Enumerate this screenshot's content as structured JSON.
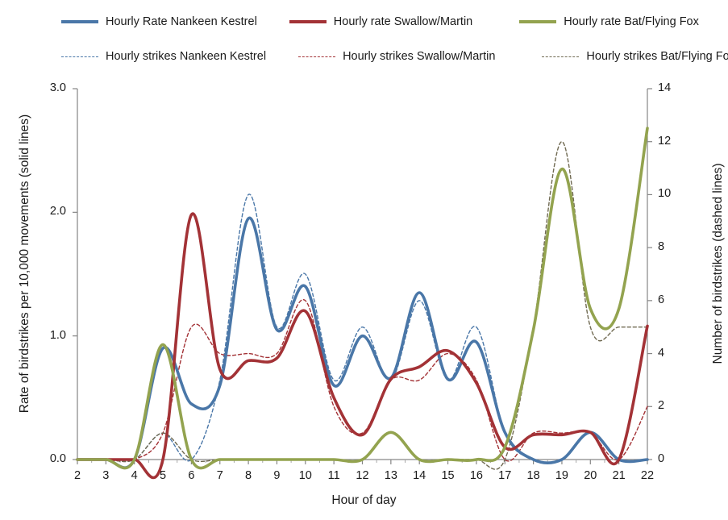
{
  "legend": {
    "rows": [
      [
        {
          "label": "Hourly Rate Nankeen Kestrel",
          "style": "solid",
          "color": "#4a77a8",
          "name": "legend-rate-nankeen-kestrel"
        },
        {
          "label": "Hourly rate Swallow/Martin",
          "style": "solid",
          "color": "#a33236",
          "name": "legend-rate-swallow-martin"
        },
        {
          "label": "Hourly rate Bat/Flying Fox",
          "style": "solid",
          "color": "#93a34f",
          "name": "legend-rate-bat-flying-fox"
        }
      ],
      [
        {
          "label": "Hourly strikes Nankeen Kestrel",
          "style": "dashed",
          "color": "#4a77a8",
          "name": "legend-strikes-nankeen-kestrel"
        },
        {
          "label": "Hourly strikes Swallow/Martin",
          "style": "dashed",
          "color": "#a33236",
          "name": "legend-strikes-swallow-martin"
        },
        {
          "label": "Hourly strikes Bat/Flying Fox",
          "style": "dashed",
          "color": "#706a52",
          "name": "legend-strikes-bat-flying-fox"
        }
      ]
    ]
  },
  "chart_data": {
    "type": "line",
    "title": "",
    "xlabel": "Hour of day",
    "ylabel": "Rate of birdstrikes per 10,000 movements (solid lines)",
    "ylabel_right": "Number of birdstrikes (dashed lines)",
    "grid": false,
    "legend_position": "top",
    "x": [
      2,
      3,
      4,
      5,
      6,
      7,
      8,
      9,
      10,
      11,
      12,
      13,
      14,
      15,
      16,
      17,
      18,
      19,
      20,
      21,
      22
    ],
    "xtick_labels": [
      "2",
      "3",
      "4",
      "5",
      "6",
      "7",
      "8",
      "9",
      "10",
      "11",
      "12",
      "13",
      "14",
      "15",
      "16",
      "17",
      "18",
      "19",
      "20",
      "21",
      "22"
    ],
    "xlim": [
      2,
      22
    ],
    "ylim": [
      0.0,
      3.0
    ],
    "ytick_labels": [
      "0.0",
      "1.0",
      "2.0",
      "3.0"
    ],
    "ytick_values": [
      0.0,
      1.0,
      2.0,
      3.0
    ],
    "ylim_right": [
      0,
      14
    ],
    "ytick_labels_right": [
      "0",
      "2",
      "4",
      "6",
      "8",
      "10",
      "12",
      "14"
    ],
    "ytick_values_right": [
      0,
      2,
      4,
      6,
      8,
      10,
      12,
      14
    ],
    "series": [
      {
        "name": "Hourly Rate Nankeen Kestrel",
        "axis": "left",
        "style": "solid",
        "color": "#4a77a8",
        "values": [
          0.0,
          0.0,
          0.0,
          0.9,
          0.45,
          0.6,
          1.95,
          1.05,
          1.4,
          0.6,
          1.0,
          0.66,
          1.35,
          0.65,
          0.95,
          0.22,
          0.0,
          0.0,
          0.22,
          0.0,
          0.0
        ]
      },
      {
        "name": "Hourly rate Swallow/Martin",
        "axis": "left",
        "style": "solid",
        "color": "#a33236",
        "values": [
          0.0,
          0.0,
          0.0,
          0.0,
          1.98,
          0.73,
          0.8,
          0.82,
          1.2,
          0.5,
          0.2,
          0.65,
          0.75,
          0.88,
          0.62,
          0.1,
          0.2,
          0.2,
          0.22,
          0.0,
          1.08
        ]
      },
      {
        "name": "Hourly rate Bat/Flying Fox",
        "axis": "left",
        "style": "solid",
        "color": "#93a34f",
        "values": [
          0.0,
          0.0,
          0.0,
          0.93,
          0.0,
          0.0,
          0.0,
          0.0,
          0.0,
          0.0,
          0.0,
          0.22,
          0.0,
          0.0,
          0.0,
          0.1,
          1.05,
          2.35,
          1.22,
          1.22,
          2.68
        ]
      },
      {
        "name": "Hourly strikes Nankeen Kestrel",
        "axis": "right",
        "style": "dashed",
        "color": "#4a77a8",
        "values": [
          0,
          0,
          0,
          1,
          0,
          3,
          10,
          5,
          7,
          3,
          5,
          3,
          6,
          3,
          5,
          1,
          0,
          0,
          1,
          0,
          0
        ]
      },
      {
        "name": "Hourly strikes Swallow/Martin",
        "axis": "right",
        "style": "dashed",
        "color": "#a33236",
        "values": [
          0,
          0,
          0,
          1,
          5,
          4,
          4,
          4,
          6,
          2,
          1,
          3,
          3,
          4,
          3,
          0,
          1,
          1,
          1,
          0,
          2
        ]
      },
      {
        "name": "Hourly strikes Bat/Flying Fox",
        "axis": "right",
        "style": "dashed",
        "color": "#706a52",
        "values": [
          0,
          0,
          0,
          1,
          0,
          0,
          0,
          0,
          0,
          0,
          0,
          1,
          0,
          0,
          0,
          0,
          5,
          12,
          5,
          5,
          5
        ]
      }
    ]
  }
}
